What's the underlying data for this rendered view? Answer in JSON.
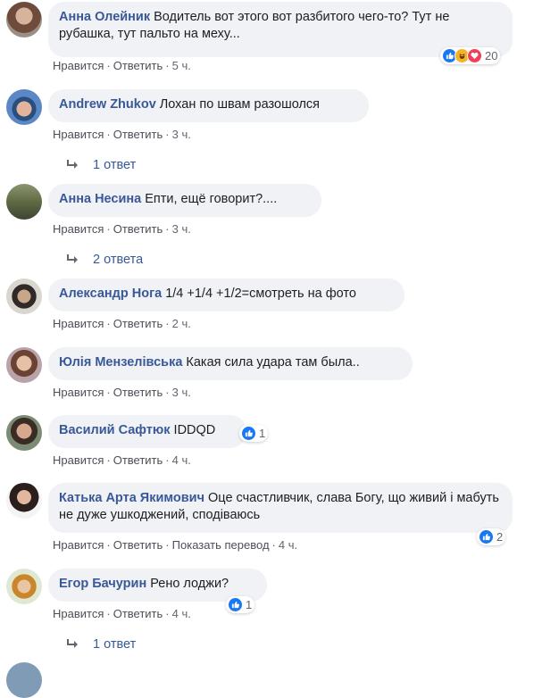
{
  "comments": [
    {
      "author": "Анна Олейник",
      "text": "Водитель вот этого вот разбитого чего-то? Тут не рубашка, тут пальто на меху...",
      "like_label": "Нравится",
      "reply_label": "Ответить",
      "time": "5 ч.",
      "reaction_count": "20",
      "reactions": [
        "like-icon",
        "haha-icon",
        "love-icon"
      ]
    },
    {
      "author": "Andrew Zhukov",
      "text": "Лохан по швам разошолся",
      "like_label": "Нравится",
      "reply_label": "Ответить",
      "time": "3 ч.",
      "replies": "1 ответ"
    },
    {
      "author": "Анна Несина",
      "text": "Епти, ещё говорит?....",
      "like_label": "Нравится",
      "reply_label": "Ответить",
      "time": "3 ч.",
      "replies": "2 ответа"
    },
    {
      "author": "Александр Нога",
      "text": "1/4 +1/4 +1/2=смотреть на фото",
      "like_label": "Нравится",
      "reply_label": "Ответить",
      "time": "2 ч."
    },
    {
      "author": "Юлія Мензелівська",
      "text": "Какая сила удара там была..",
      "like_label": "Нравится",
      "reply_label": "Ответить",
      "time": "3 ч."
    },
    {
      "author": "Василий Сафтюк",
      "text": "IDDQD",
      "like_label": "Нравится",
      "reply_label": "Ответить",
      "time": "4 ч.",
      "reaction_count": "1",
      "reactions": [
        "like-icon"
      ]
    },
    {
      "author": "Катька Арта Якимович",
      "text": "Оце счастливчик, слава Богу, що живий і мабуть не дуже ушкоджений, сподіваюсь",
      "like_label": "Нравится",
      "reply_label": "Ответить",
      "translate_label": "Показать перевод",
      "time": "4 ч.",
      "reaction_count": "2",
      "reactions": [
        "like-icon"
      ]
    },
    {
      "author": "Егор Бачурин",
      "text": "Рено лоджи?",
      "like_label": "Нравится",
      "reply_label": "Ответить",
      "time": "4 ч.",
      "reaction_count": "1",
      "reactions": [
        "like-icon"
      ],
      "replies": "1 ответ"
    }
  ],
  "colors": {
    "author": "#385898",
    "bubble": "#f0f2f5",
    "meta": "#606770",
    "like": "#1877f2"
  }
}
